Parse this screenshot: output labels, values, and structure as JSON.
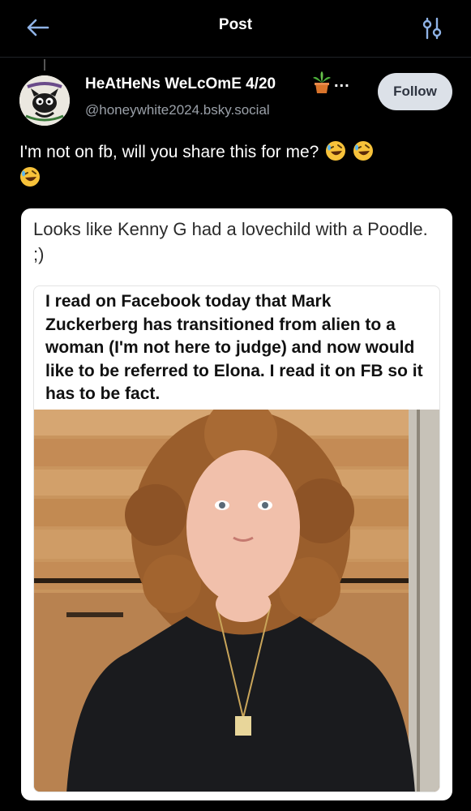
{
  "header": {
    "title": "Post",
    "back_icon": "arrow-left-icon",
    "filter_icon": "sliders-icon"
  },
  "post": {
    "author_name": "HeAtHeNs WeLcOmE 4/20",
    "name_emoji": "potted-plant-emoji",
    "more_label": "...",
    "handle": "@honeywhite2024.bsky.social",
    "follow_label": "Follow",
    "text": "I'm not on fb, will you share this for me?",
    "text_emojis": [
      "rolling-on-floor-laughing",
      "rolling-on-floor-laughing",
      "rolling-on-floor-laughing"
    ],
    "avatar": {
      "description_icon": "cartoon-cat-avatar",
      "top_text": "WICKED SMOKING ANGEL",
      "bottom_text": "I'm Love Weed"
    }
  },
  "embed": {
    "caption": "Looks like Kenny G had a lovechild with a Poodle.  ;)",
    "inner_text": "I read on Facebook today that Mark Zuckerberg has transitioned from alien to a woman (I'm not here to judge) and now would like to be referred to Elona. I read it on FB so it has to be fact."
  },
  "colors": {
    "background": "#000000",
    "follow_bg": "#dce1e8",
    "handle": "#9aa0a8"
  }
}
